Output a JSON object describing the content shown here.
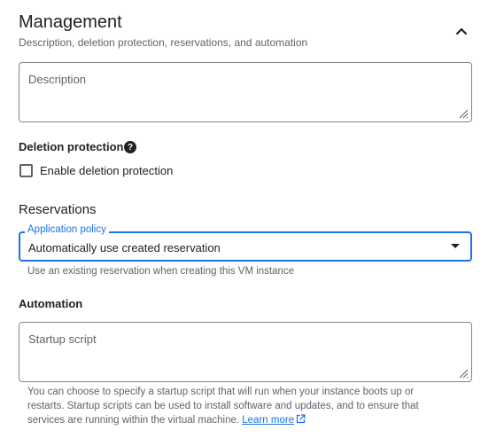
{
  "header": {
    "title": "Management",
    "subtitle": "Description, deletion protection, reservations, and automation",
    "collapse_icon": "chevron-up-icon"
  },
  "description": {
    "placeholder": "Description"
  },
  "deletion_protection": {
    "label": "Deletion protection",
    "help_icon": "help-icon",
    "help_glyph": "?",
    "checkbox_label": "Enable deletion protection",
    "checked": false
  },
  "reservations": {
    "heading": "Reservations",
    "policy_label": "Application policy",
    "policy_value": "Automatically use created reservation",
    "policy_hint": "Use an existing reservation when creating this VM instance"
  },
  "automation": {
    "label": "Automation",
    "startup_placeholder": "Startup script",
    "help_text": "You can choose to specify a startup script that will run when your instance boots up or restarts. Startup scripts can be used to install software and updates, and to ensure that services are running within the virtual machine.",
    "learn_more": "Learn more"
  },
  "colors": {
    "accent": "#1a73e8",
    "text": "#202124",
    "secondary_text": "#5f6368"
  }
}
